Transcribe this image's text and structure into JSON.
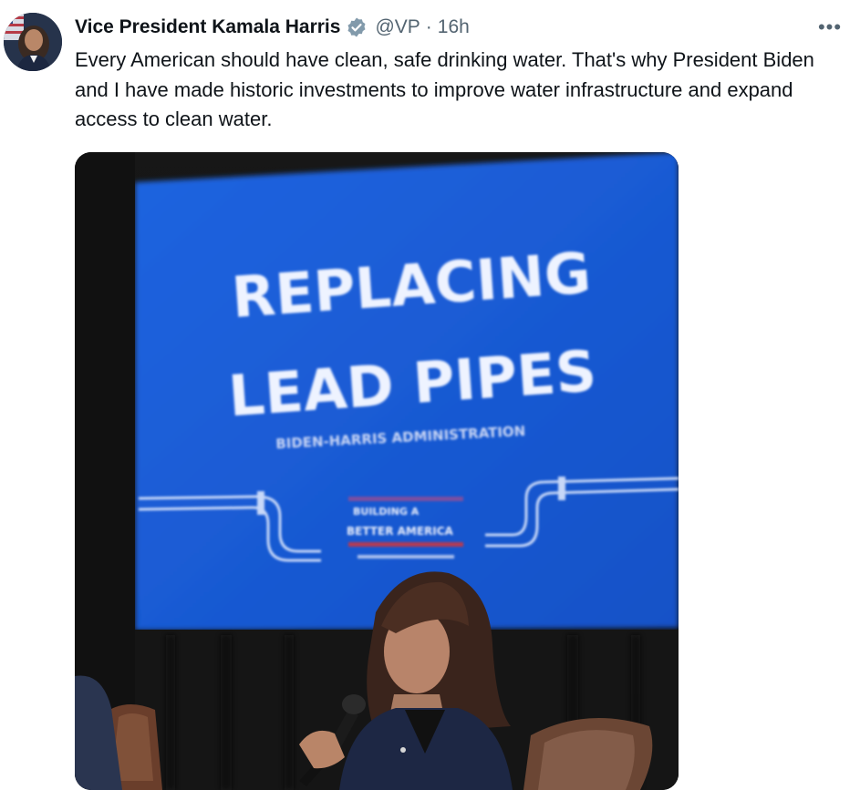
{
  "tweet": {
    "author_name": "Vice President Kamala Harris",
    "handle": "@VP",
    "separator": "·",
    "time": "16h",
    "text": "Every American should have clean, safe drinking water. That's why President Biden and I have made historic investments to improve water infrastructure and expand access to clean water.",
    "more_label": "•••"
  },
  "media": {
    "screen_title_line1": "REPLACING",
    "screen_title_line2": "LEAD PIPES",
    "screen_subtitle": "BIDEN-HARRIS ADMINISTRATION",
    "screen_logo_line1": "BUILDING A",
    "screen_logo_line2": "BETTER AMERICA"
  },
  "colors": {
    "verified": "#829aab",
    "screen_blue": "#1659d6",
    "muted_text": "#536471"
  },
  "icons": {
    "verified": "verified-badge-icon",
    "more": "more-options-icon"
  }
}
